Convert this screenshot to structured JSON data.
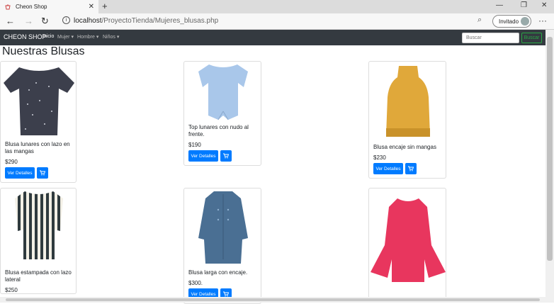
{
  "browser": {
    "tab_title": "Cheon Shop",
    "url_host": "localhost",
    "url_path": "/ProyectoTienda/Mujeres_blusas.php",
    "profile_label": "Invitado"
  },
  "site": {
    "brand": "CHEON SHOP",
    "nav": [
      {
        "label": "Inicio"
      },
      {
        "label": "Mujer"
      },
      {
        "label": "Hombre"
      },
      {
        "label": "Niños"
      }
    ],
    "search_placeholder": "Buscar",
    "search_button": "Buscar"
  },
  "page": {
    "title": "Nuestras Blusas"
  },
  "products": [
    {
      "name": "Blusa lunares con lazo en las mangas",
      "price": "$290",
      "color": "#3c3f4c"
    },
    {
      "name": "Top lunares con nudo al frente.",
      "price": "$190",
      "color": "#a9c7ea"
    },
    {
      "name": "Blusa encaje sin mangas",
      "price": "$230",
      "color": "#e0a83a"
    },
    {
      "name": "Blusa estampada con lazo lateral",
      "price": "$250",
      "color": "#2f3a3e"
    },
    {
      "name": "Blusa larga con encaje.",
      "price": "$300.",
      "color": "#4a6f93"
    },
    {
      "name": "",
      "price": "",
      "color": "#e8365e"
    }
  ],
  "buttons": {
    "details": "Ver Detalles"
  }
}
